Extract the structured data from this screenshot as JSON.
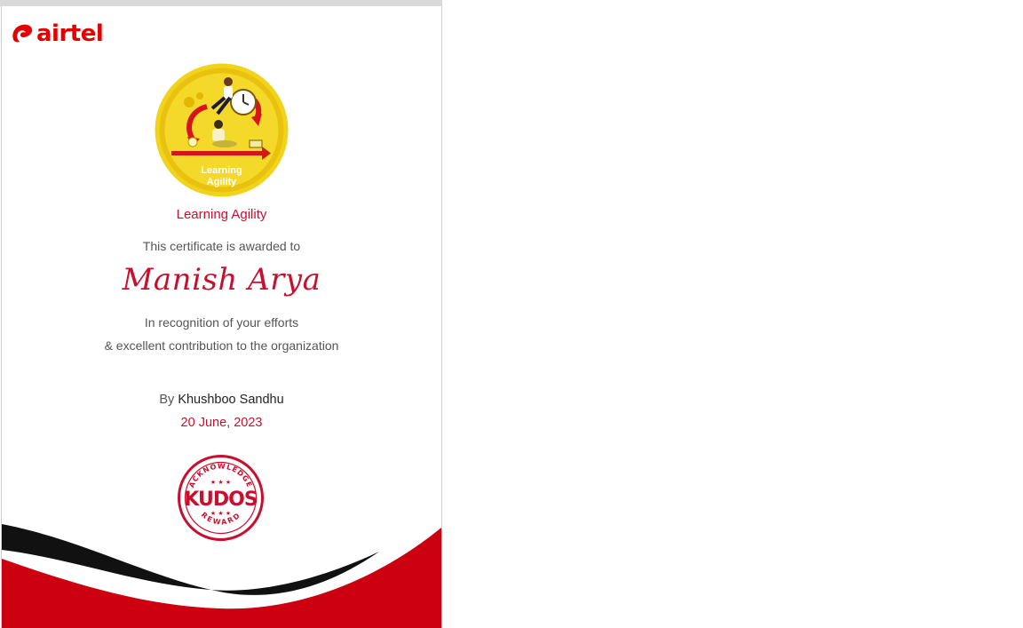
{
  "brand": {
    "name": "airtel",
    "color": "#e40000"
  },
  "badge": {
    "caption_line1": "Learning",
    "caption_line2": "Agility",
    "fill_color": "#f2d31b"
  },
  "certificate": {
    "badge_name": "Learning Agility",
    "awarded_text": "This certificate is awarded to",
    "recipient": "Manish Arya",
    "recognition_line1": "In recognition of your efforts",
    "recognition_line2": "& excellent contribution to the organization",
    "by_prefix": "By",
    "giver": "Khushboo Sandhu",
    "date": "20 June, 2023"
  },
  "stamp": {
    "top_text": "ACKNOWLEDGE",
    "main_text": "KUDOS",
    "bottom_text": "REWARD",
    "color": "#c8102e"
  },
  "colors": {
    "accent_red": "#c8102e",
    "wave_red": "#cc0010",
    "wave_black": "#111111"
  }
}
